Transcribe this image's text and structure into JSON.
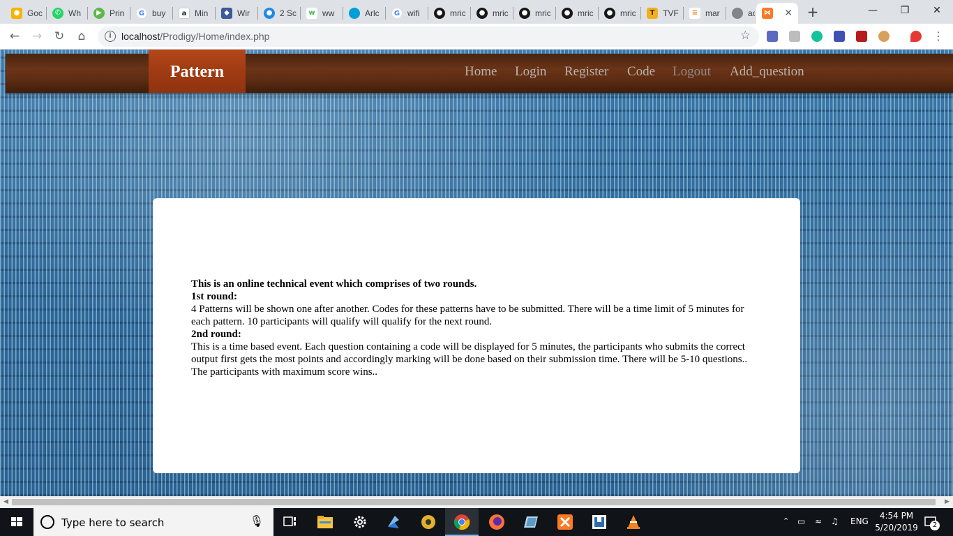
{
  "browser": {
    "tabs": [
      {
        "label": "Goc",
        "icon": "google-keep-icon",
        "color": "#f6b400"
      },
      {
        "label": "Wh",
        "icon": "whatsapp-icon",
        "color": "#25d366"
      },
      {
        "label": "Prin",
        "icon": "play-icon",
        "color": "#5fb84a"
      },
      {
        "label": "buy",
        "icon": "google-icon",
        "color": "#4285f4"
      },
      {
        "label": "Min",
        "icon": "amazon-icon",
        "color": "#232f3e"
      },
      {
        "label": "Wir",
        "icon": "shield-icon",
        "color": "#3d5a98"
      },
      {
        "label": "2 Sc",
        "icon": "chat-icon",
        "color": "#1e88e5"
      },
      {
        "label": "ww",
        "icon": "w-icon",
        "color": "#e8f0fe"
      },
      {
        "label": "Arlc",
        "icon": "cloud-icon",
        "color": "#009edb"
      },
      {
        "label": "wifi",
        "icon": "google-icon",
        "color": "#4285f4"
      },
      {
        "label": "mric",
        "icon": "github-icon",
        "color": "#181717"
      },
      {
        "label": "mric",
        "icon": "github-icon",
        "color": "#181717"
      },
      {
        "label": "mric",
        "icon": "github-icon",
        "color": "#181717"
      },
      {
        "label": "mric",
        "icon": "github-icon",
        "color": "#181717"
      },
      {
        "label": "mric",
        "icon": "github-icon",
        "color": "#181717"
      },
      {
        "label": "TVF",
        "icon": "tvf-icon",
        "color": "#f2b01e"
      },
      {
        "label": "mar",
        "icon": "stackoverflow-icon",
        "color": "#f48024"
      },
      {
        "label": "acn",
        "icon": "globe-icon",
        "color": "#5f6368"
      },
      {
        "label": "",
        "icon": "xampp-icon",
        "color": "#fb7a24",
        "active": true
      }
    ],
    "url_host": "localhost",
    "url_path": "/Prodigy/Home/index.php"
  },
  "site": {
    "brand": "Pattern",
    "nav": [
      "Home",
      "Login",
      "Register",
      "Code",
      "Logout",
      "Add_question"
    ]
  },
  "content": {
    "intro": "This is an online technical event which comprises of two rounds.",
    "round1_title": "1st round:",
    "round1_text": "4 Patterns will be shown one after another. Codes for these patterns have to be submitted. There will be a time limit of 5 minutes for each pattern. 10 participants will qualify will qualify for the next round.",
    "round2_title": "2nd round:",
    "round2_text": "This is a time based event. Each question containing a code will be displayed for 5 minutes, the participants who submits the correct output first gets the most points and accordingly marking will be done based on their submission time. There will be 5-10 questions.. The participants with maximum score wins.."
  },
  "taskbar": {
    "search_placeholder": "Type here to search",
    "language": "ENG",
    "time": "4:54 PM",
    "date": "5/20/2019",
    "notifications": "2"
  },
  "colors": {
    "navbar": "#5a2b12",
    "brand_bg": "#a33d14",
    "nav_text": "#b9b3ad",
    "page_bg": "#2f6a9a",
    "taskbar": "#101318"
  }
}
